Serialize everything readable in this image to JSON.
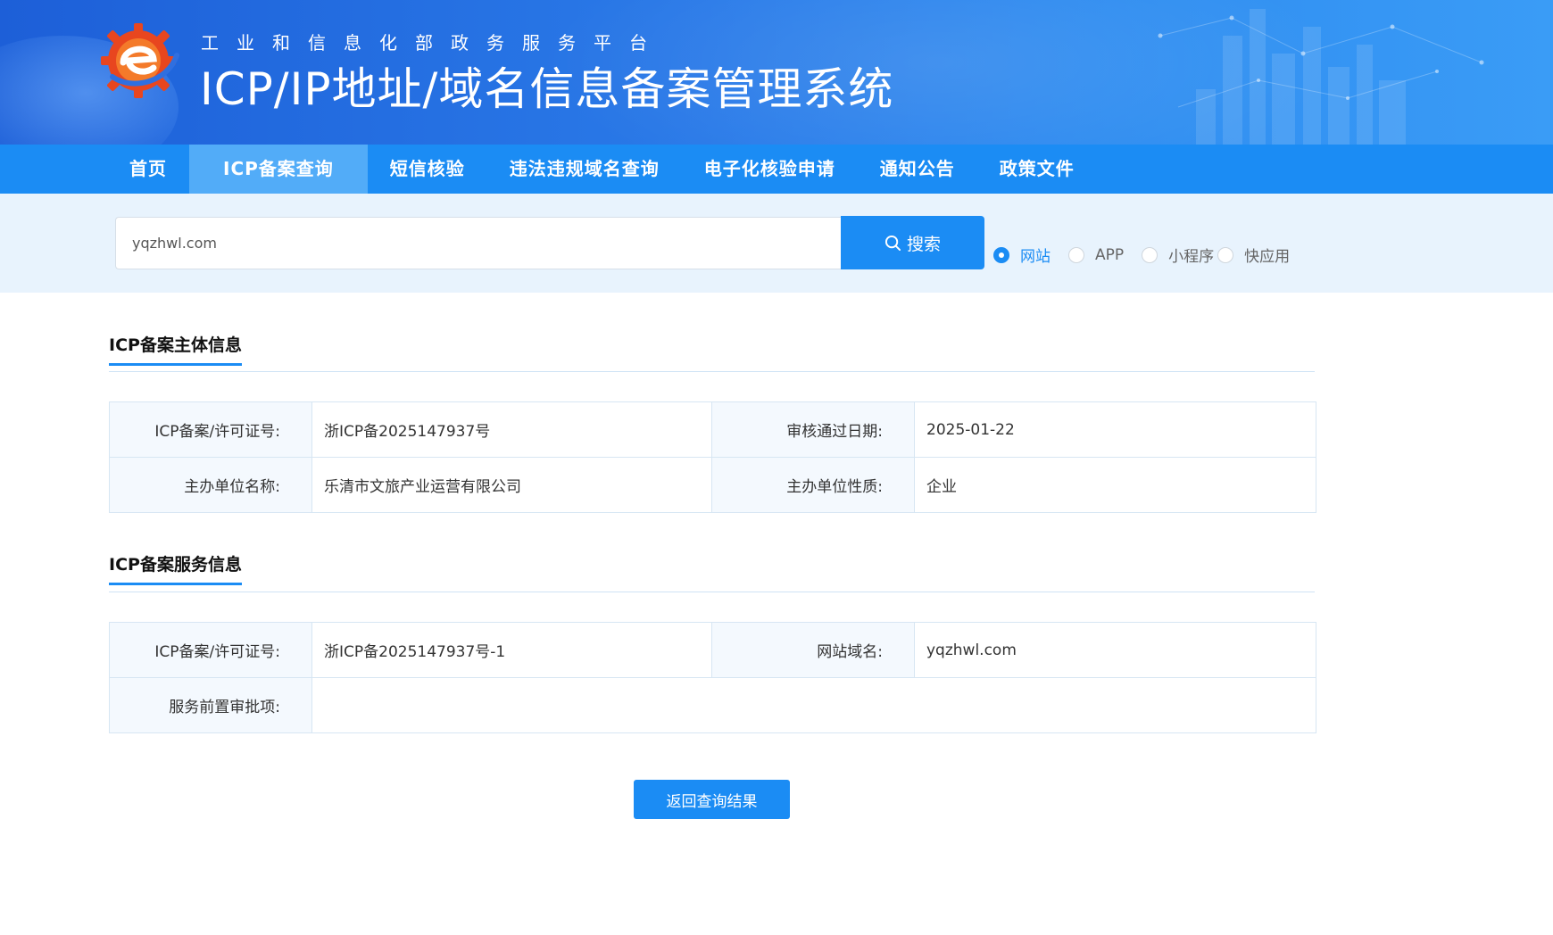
{
  "header": {
    "subtitle": "工业和信息化部政务服务平台",
    "title": "ICP/IP地址/域名信息备案管理系统"
  },
  "nav": {
    "items": [
      "首页",
      "ICP备案查询",
      "短信核验",
      "违法违规域名查询",
      "电子化核验申请",
      "通知公告",
      "政策文件"
    ],
    "active": "ICP备案查询"
  },
  "search": {
    "value": "yqzhwl.com",
    "button_label": "搜索",
    "types": [
      "网站",
      "APP",
      "小程序",
      "快应用"
    ],
    "selected_type": "网站"
  },
  "subject_section": {
    "title": "ICP备案主体信息",
    "rows": [
      [
        {
          "label": "ICP备案/许可证号:",
          "value": "浙ICP备2025147937号"
        },
        {
          "label": "审核通过日期:",
          "value": "2025-01-22"
        }
      ],
      [
        {
          "label": "主办单位名称:",
          "value": "乐清市文旅产业运营有限公司"
        },
        {
          "label": "主办单位性质:",
          "value": "企业"
        }
      ]
    ]
  },
  "service_section": {
    "title": "ICP备案服务信息",
    "row1": [
      {
        "label": "ICP备案/许可证号:",
        "value": "浙ICP备2025147937号-1"
      },
      {
        "label": "网站域名:",
        "value": "yqzhwl.com"
      }
    ],
    "row2": {
      "label": "服务前置审批项:",
      "value": ""
    }
  },
  "back_button_label": "返回查询结果",
  "colors": {
    "primary": "#1b8cf4",
    "nav_active": "#52acf8",
    "band": "#e8f3fd",
    "label_bg": "#f4f9fe"
  },
  "icons": {
    "logo": "miit-gear-e-logo",
    "search": "search-icon"
  }
}
